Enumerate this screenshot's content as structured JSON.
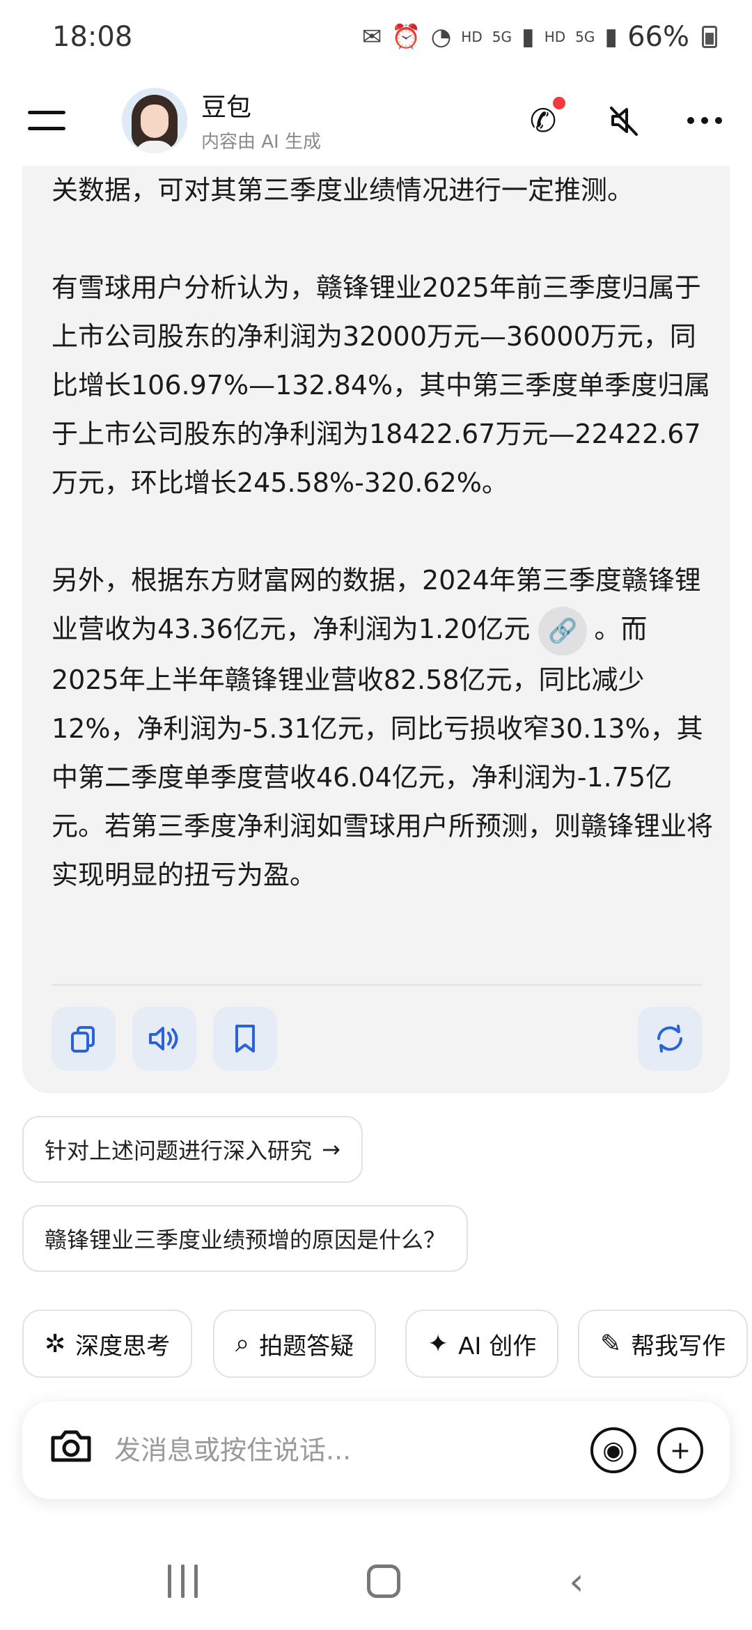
{
  "status_bar": {
    "time": "18:08",
    "battery": "66%",
    "network_1": "HD",
    "network_2": "5G",
    "network_3": "HD",
    "network_4": "5G"
  },
  "header": {
    "bot_name": "豆包",
    "subtitle": "内容由 AI 生成"
  },
  "message": {
    "line_partial": "关数据，可对其第三季度业绩情况进行一定推测。",
    "paragraph_2": "有雪球用户分析认为，赣锋锂业2025年前三季度归属于上市公司股东的净利润为32000万元—36000万元，同比增长106.97%—132.84%，其中第三季度单季度归属于上市公司股东的净利润为18422.67万元—22422.67万元，环比增长245.58%-320.62%。",
    "paragraph_3_a": "另外，根据东方财富网的数据，2024年第三季度赣锋锂业营收为43.36亿元，净利润为1.20亿元",
    "paragraph_3_b": "。而2025年上半年赣锋锂业营收82.58亿元，同比减少12%，净利润为-5.31亿元，同比亏损收窄30.13%，其中第二季度单季度营收46.04亿元，净利润为-1.75亿元。若第三季度净利润如雪球用户所预测，则赣锋锂业将实现明显的扭亏为盈。"
  },
  "suggestions": {
    "deep_research": "针对上述问题进行深入研究",
    "deep_research_arrow": "→",
    "question": "赣锋锂业三季度业绩预增的原因是什么？"
  },
  "tools": {
    "deep_think": "深度思考",
    "photo_answer": "拍题答疑",
    "ai_create": "AI 创作",
    "help_write": "帮我写作"
  },
  "input": {
    "placeholder": "发消息或按住说话..."
  },
  "colors": {
    "accent": "#2a63d8",
    "bubble_bg": "#f3f3f4",
    "notification_dot": "#f23a3a"
  }
}
